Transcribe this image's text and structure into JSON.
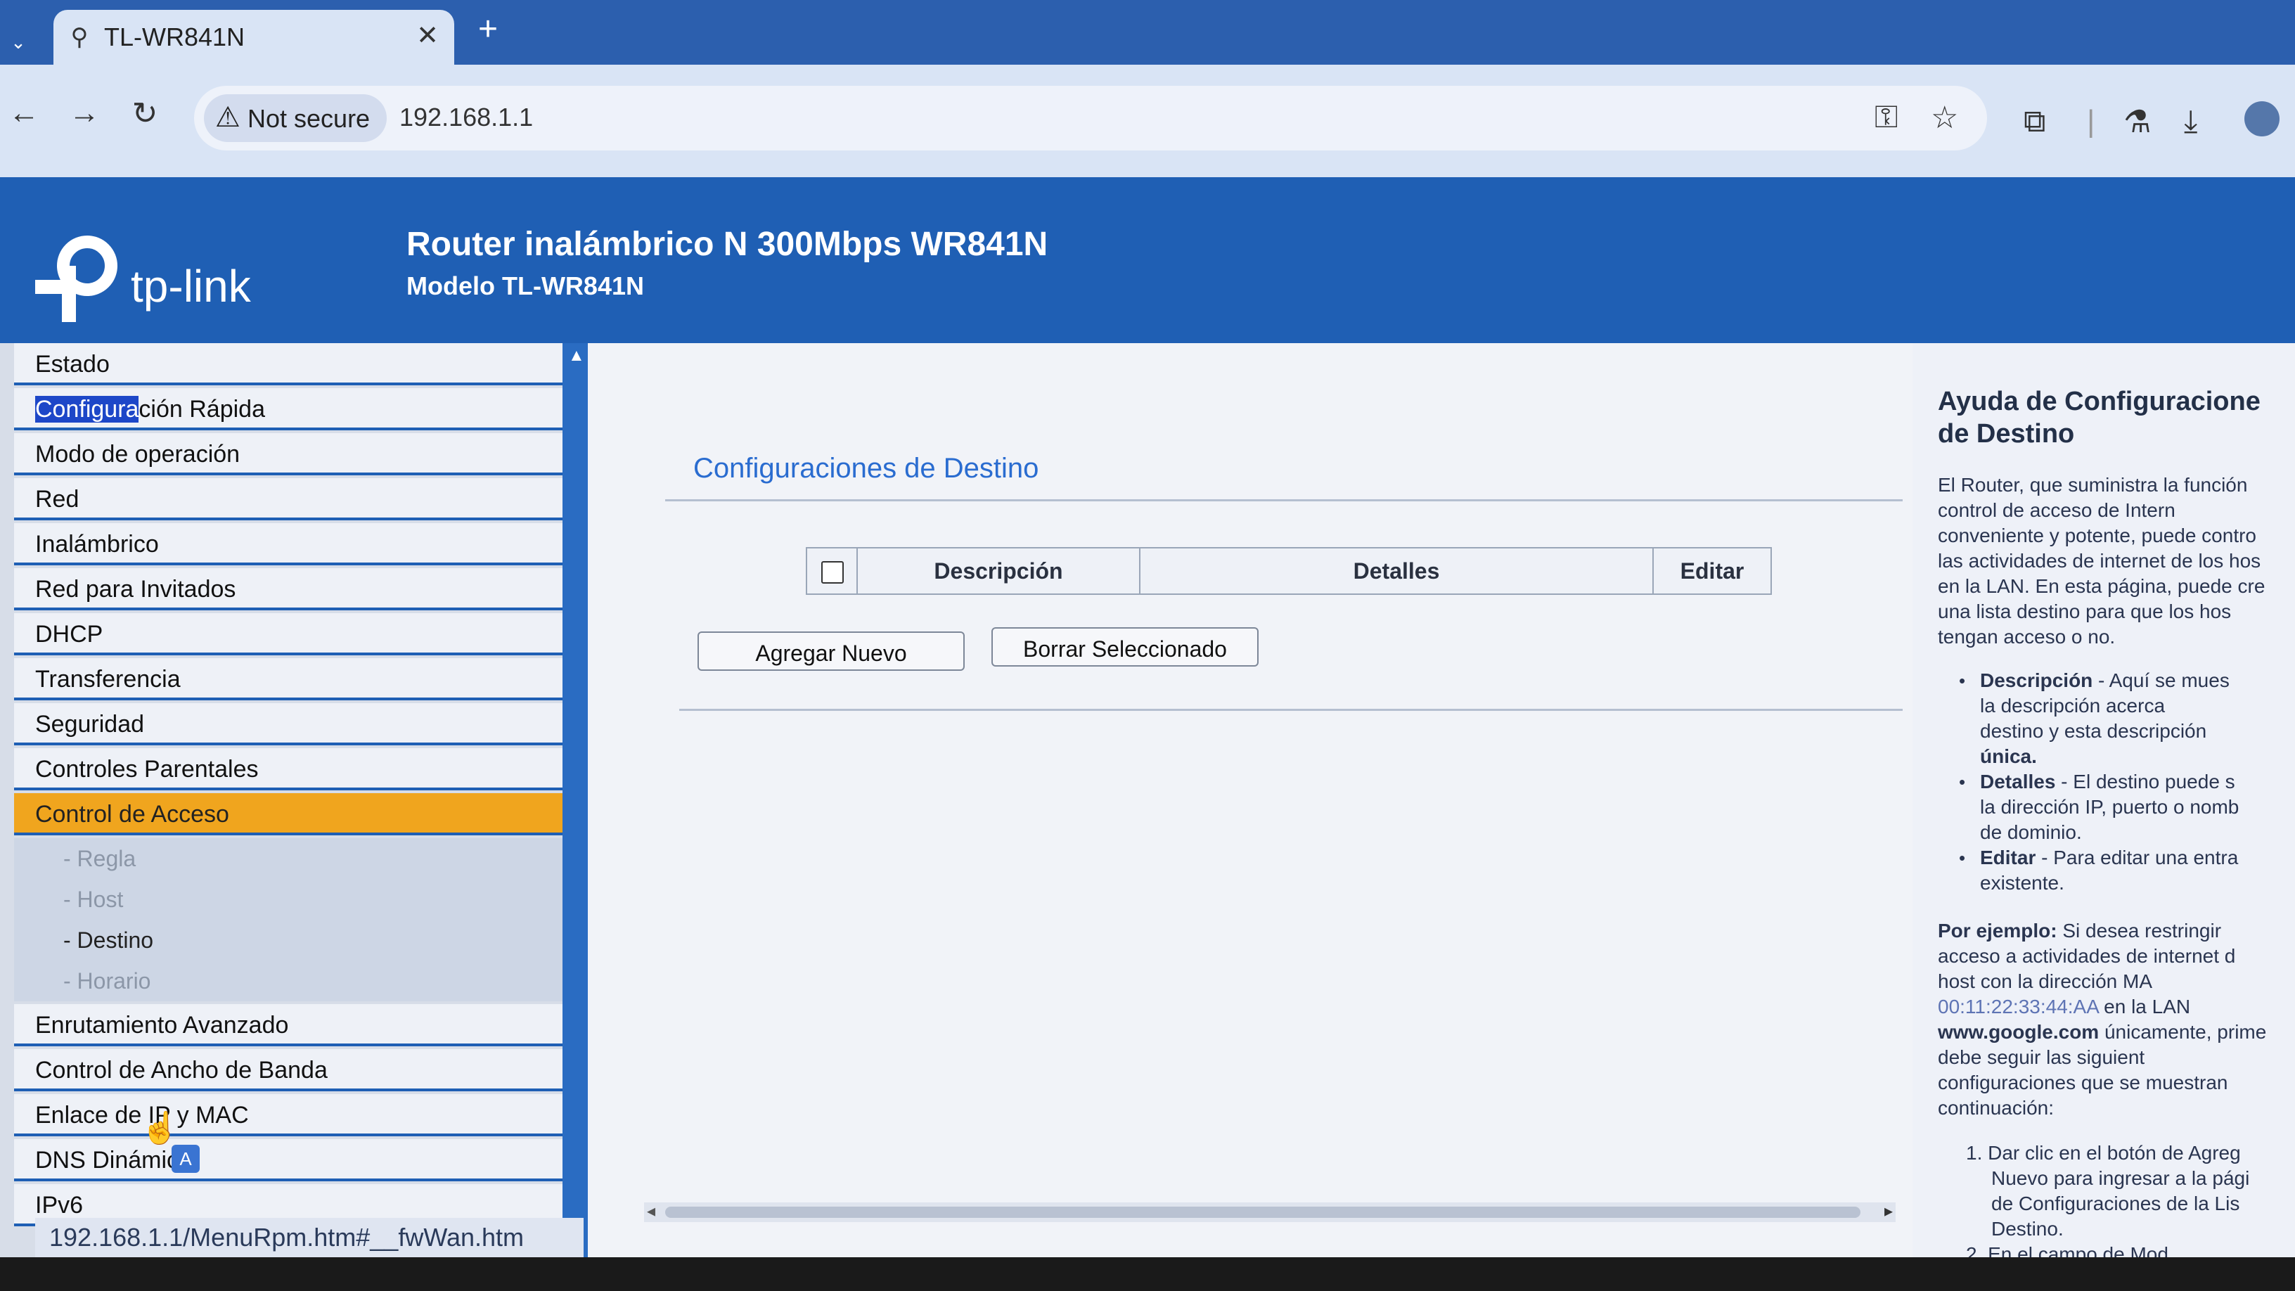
{
  "browser": {
    "tab_title": "TL-WR841N",
    "security_label": "Not secure",
    "url": "192.168.1.1",
    "status_url": "192.168.1.1/MenuRpm.htm#__fwWan.htm",
    "colors": {
      "tabstrip": "#2c5fae",
      "toolbar": "#d9e4f5"
    }
  },
  "banner": {
    "logo_text": "tp-link",
    "title": "Router inalámbrico N 300Mbps WR841N",
    "subtitle": "Modelo TL-WR841N",
    "color": "#1f5fb4"
  },
  "menu": {
    "items": [
      {
        "label": "Estado"
      },
      {
        "label_highlight": "Configura",
        "label_rest": "ción Rápida"
      },
      {
        "label": "Modo de operación"
      },
      {
        "label": "Red"
      },
      {
        "label": "Inalámbrico"
      },
      {
        "label": "Red para Invitados"
      },
      {
        "label": "DHCP"
      },
      {
        "label": "Transferencia"
      },
      {
        "label": "Seguridad"
      },
      {
        "label": "Controles Parentales"
      },
      {
        "label": "Control de Acceso"
      },
      {
        "label": "Enrutamiento Avanzado"
      },
      {
        "label": "Control de Ancho de Banda"
      },
      {
        "label": "Enlace de IP y MAC"
      },
      {
        "label": "DNS Dinámico"
      },
      {
        "label": "IPv6"
      }
    ],
    "subitems": [
      {
        "label": "- Regla"
      },
      {
        "label": "- Host"
      },
      {
        "label": "- Destino"
      },
      {
        "label": "- Horario"
      }
    ],
    "active_color": "#f0a51e"
  },
  "main": {
    "title": "Configuraciones de Destino",
    "table_headers": [
      "Descripción",
      "Detalles",
      "Editar"
    ],
    "buttons": {
      "add_new": "Agregar Nuevo",
      "delete_selected": "Borrar Seleccionado"
    }
  },
  "help": {
    "title_line1": "Ayuda de Configuracione",
    "title_line2": "de Destino",
    "intro": [
      "El Router, que suministra la función",
      "control de acceso de Intern",
      "conveniente y potente, puede contro",
      "las actividades de internet de los hos",
      "en la LAN. En esta página, puede cre",
      "una lista destino para que los hos",
      "tengan acceso o no."
    ],
    "bullets": [
      {
        "term": "Descripción",
        "lines": [
          " - Aquí se mues",
          "la descripción acerca",
          "destino y esta descripción",
          "única."
        ]
      },
      {
        "term": "Detalles",
        "lines": [
          " - El destino puede s",
          "la dirección IP, puerto o nomb",
          "de dominio."
        ]
      },
      {
        "term": "Editar",
        "lines": [
          " - Para editar una entra",
          "existente."
        ]
      }
    ],
    "example": {
      "lead": "Por ejemplo:",
      "line1_rest": " Si desea restringir",
      "line2": "acceso a actividades de internet d",
      "line3": "host con la dirección MA",
      "mac": "00:11:22:33:44:AA",
      "line4_rest": " en la LAN",
      "domain": "www.google.com",
      "line5_rest": " únicamente, prime",
      "line6": "debe seguir las siguient",
      "line7": "configuraciones que se muestran",
      "line8": "continuación:"
    },
    "steps": [
      "1. Dar clic en el botón de Agreg",
      "Nuevo para ingresar a la pági",
      "de Configuraciones de la Lis",
      "Destino.",
      "2. En el campo de Mod"
    ]
  }
}
